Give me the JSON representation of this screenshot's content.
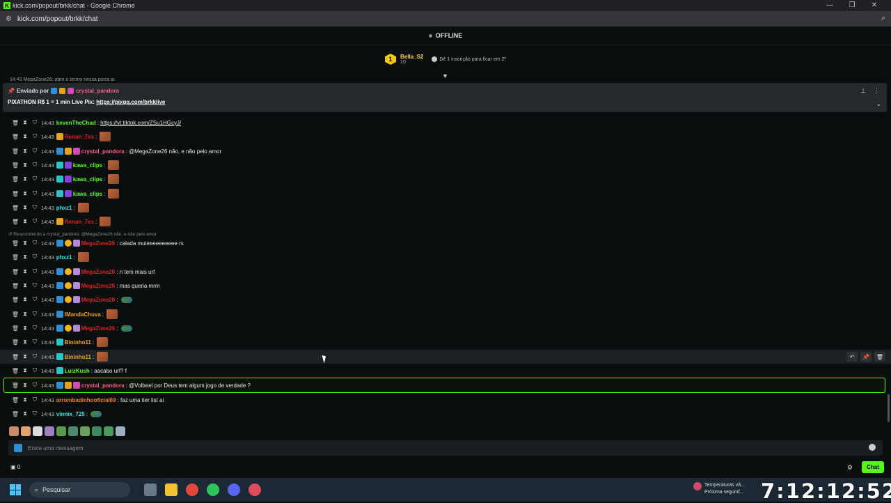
{
  "browser": {
    "window_title": "kick.com/popout/brkk/chat - Google Chrome",
    "url": "kick.com/popout/brkk/chat"
  },
  "stream": {
    "status": "OFFLINE"
  },
  "leaderboard": {
    "rank": "1",
    "name": "Bella_S2",
    "count": "10",
    "hint": "Dê 1 inscrição para ficar em 2º"
  },
  "pinned": {
    "sent_by_label": "Enviado por",
    "user": "crystal_pandora",
    "message_prefix": "PIXATHON R$ 1 = 1 min Live Pix: ",
    "link": "https://pixgg.com/brkklive"
  },
  "cut_top_text": "14:43  MegaZone26: abre o termo nessa porra ai",
  "reply_note": "Respondendo a crystal_pandora: @MegaZone26 não, e não pelo amor",
  "messages": [
    {
      "time": "14:43",
      "user": "kevenTheChad",
      "color": "#53fc18",
      "text": "",
      "link": "https://vt.tiktok.com/ZSu1HGcyJ/",
      "emote": false
    },
    {
      "time": "14:43",
      "user": "Renan_7xs",
      "color": "#e02020",
      "text": "",
      "emote": true
    },
    {
      "time": "14:43",
      "user": "crystal_pandora",
      "color": "#ff5a8a",
      "text": "@MegaZone26 não, e não pelo amor",
      "emote": false
    },
    {
      "time": "14:43",
      "user": "kawa_clips",
      "color": "#53fc18",
      "text": "",
      "emote": true
    },
    {
      "time": "14:43",
      "user": "kawa_clips",
      "color": "#53fc18",
      "text": "",
      "emote": true
    },
    {
      "time": "14:43",
      "user": "kawa_clips",
      "color": "#53fc18",
      "text": "",
      "emote": true
    },
    {
      "time": "14:43",
      "user": "phxz1",
      "color": "#2ee6e6",
      "text": "",
      "emote": true
    },
    {
      "time": "14:43",
      "user": "Renan_7xs",
      "color": "#e02020",
      "text": "",
      "emote": true
    },
    {
      "time": "14:43",
      "user": "MegaZone26",
      "color": "#e02020",
      "text": "calada muieeeeeeeeee rs",
      "emote": false
    },
    {
      "time": "14:43",
      "user": "phxz1",
      "color": "#2ee6e6",
      "text": "",
      "emote": true
    },
    {
      "time": "14:43",
      "user": "MegaZone26",
      "color": "#e02020",
      "text": "n tem mais urf",
      "emote": false
    },
    {
      "time": "14:43",
      "user": "MegaZone26",
      "color": "#e02020",
      "text": "mas queria mrm",
      "emote": false
    },
    {
      "time": "14:43",
      "user": "MegaZone26",
      "color": "#e02020",
      "text": "",
      "emote": true
    },
    {
      "time": "14:43",
      "user": "IMandaChuva",
      "color": "#f0a020",
      "text": "",
      "emote": true
    },
    {
      "time": "14:43",
      "user": "MegaZone26",
      "color": "#e02020",
      "text": "",
      "emote": true
    },
    {
      "time": "14:43",
      "user": "Bininho11",
      "color": "#f0a020",
      "text": "",
      "emote": true
    },
    {
      "time": "14:43",
      "user": "Bininho11",
      "color": "#f0a020",
      "text": "",
      "emote": true
    },
    {
      "time": "14:43",
      "user": "LuizKush",
      "color": "#53fc18",
      "text": "aacabo urf? f",
      "emote": false
    },
    {
      "time": "14:43",
      "user": "crystal_pandora",
      "color": "#ff5a8a",
      "text": "@Volbeel por Deus tem algum jogo de verdade ?",
      "emote": false
    },
    {
      "time": "14:43",
      "user": "arrombadinhooficial69",
      "color": "#f08020",
      "text": "faz uma tier list ai",
      "emote": false
    },
    {
      "time": "14:43",
      "user": "vinnix_725",
      "color": "#2ee6e6",
      "text": "",
      "emote": true
    }
  ],
  "input": {
    "placeholder": "Envie uma mensagem"
  },
  "bottom": {
    "points": "0",
    "chat_button": "Chat"
  },
  "taskbar": {
    "search_label": "Pesquisar",
    "weather_line1": "Temperaturas vã...",
    "weather_line2": "Próxima segund..."
  },
  "overlay_clock": "7:12:12:52",
  "colors": {
    "kick_green": "#53fc18",
    "background": "#0b0e0f"
  }
}
